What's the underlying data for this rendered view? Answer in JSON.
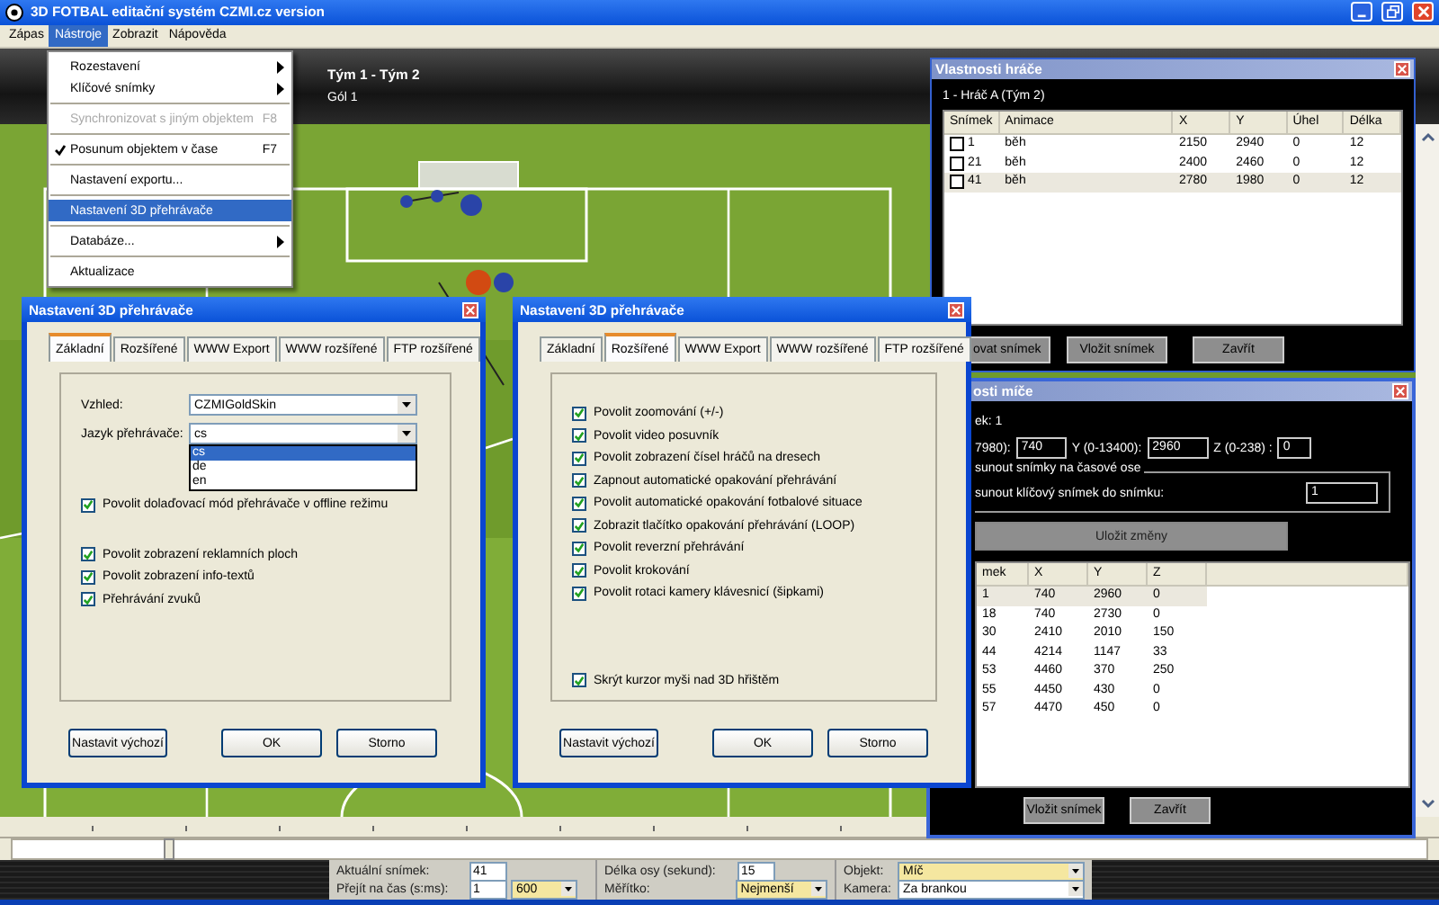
{
  "window": {
    "title": "3D FOTBAL editační systém CZMI.cz version",
    "menu": [
      {
        "label": "Zápas",
        "selected": false
      },
      {
        "label": "Nástroje",
        "selected": true
      },
      {
        "label": "Zobrazit",
        "selected": false
      },
      {
        "label": "Nápověda",
        "selected": false
      }
    ]
  },
  "menu_dropdown": [
    {
      "kind": "item",
      "label": "Rozestavení",
      "submenu": true,
      "disabled": false,
      "checked": false,
      "selected": false
    },
    {
      "kind": "item",
      "label": "Klíčové snímky",
      "submenu": true,
      "disabled": false,
      "checked": false,
      "selected": false
    },
    {
      "kind": "separator"
    },
    {
      "kind": "item",
      "label": "Synchronizovat s jiným objektem",
      "shortcut": "F8",
      "submenu": false,
      "disabled": true,
      "checked": false,
      "selected": false
    },
    {
      "kind": "separator"
    },
    {
      "kind": "item",
      "label": "Posunum objektem v čase",
      "shortcut": "F7",
      "submenu": false,
      "disabled": false,
      "checked": true,
      "selected": false
    },
    {
      "kind": "separator"
    },
    {
      "kind": "item",
      "label": "Nastavení exportu...",
      "submenu": false,
      "disabled": false,
      "checked": false,
      "selected": false
    },
    {
      "kind": "separator"
    },
    {
      "kind": "item",
      "label": "Nastavení 3D přehrávače",
      "submenu": false,
      "disabled": false,
      "checked": false,
      "selected": true
    },
    {
      "kind": "separator"
    },
    {
      "kind": "item",
      "label": "Databáze...",
      "submenu": true,
      "disabled": false,
      "checked": false,
      "selected": false
    },
    {
      "kind": "separator"
    },
    {
      "kind": "item",
      "label": "Aktualizace",
      "submenu": false,
      "disabled": false,
      "checked": false,
      "selected": false
    }
  ],
  "header": {
    "match": "Tým 1 - Tým 2",
    "event": "Gól 1"
  },
  "player_window": {
    "title": "Vlastnosti hráče",
    "subtitle": "1 - Hráč A (Tým 2)",
    "columns": [
      "Snímek",
      "Animace",
      "X",
      "Y",
      "Úhel",
      "Délka"
    ],
    "rows": [
      {
        "checked": false,
        "selected": false,
        "cells": [
          "1",
          "běh",
          "2150",
          "2940",
          "0",
          "12"
        ]
      },
      {
        "checked": false,
        "selected": false,
        "cells": [
          "21",
          "běh",
          "2400",
          "2460",
          "0",
          "12"
        ]
      },
      {
        "checked": false,
        "selected": true,
        "cells": [
          "41",
          "běh",
          "2780",
          "1980",
          "0",
          "12"
        ]
      }
    ],
    "buttons": [
      "ovat snímek",
      "Vložit snímek",
      "Zavřít"
    ]
  },
  "ball_window": {
    "title": "osti míče",
    "frame": "ek: 1",
    "coords": [
      {
        "label": "7980):",
        "value": "740"
      },
      {
        "label": "Y (0-13400):",
        "value": "2960"
      },
      {
        "label": "Z (0-238) :",
        "value": "0"
      }
    ],
    "group": {
      "legend": "sunout snímky na časové ose",
      "label": "sunout klíčový snímek do snímku:",
      "value": "1"
    },
    "save_button": "Uložit změny",
    "columns": [
      "mek",
      "X",
      "Y",
      "Z"
    ],
    "rows": [
      {
        "selected": true,
        "cells": [
          "1",
          "740",
          "2960",
          "0"
        ]
      },
      {
        "selected": false,
        "cells": [
          "18",
          "740",
          "2730",
          "0"
        ]
      },
      {
        "selected": false,
        "cells": [
          "30",
          "2410",
          "2010",
          "150"
        ]
      },
      {
        "selected": false,
        "cells": [
          "44",
          "4214",
          "1147",
          "33"
        ]
      },
      {
        "selected": false,
        "cells": [
          "53",
          "4460",
          "370",
          "250"
        ]
      },
      {
        "selected": false,
        "cells": [
          "55",
          "4450",
          "430",
          "0"
        ]
      },
      {
        "selected": false,
        "cells": [
          "57",
          "4470",
          "450",
          "0"
        ]
      }
    ],
    "buttons": [
      "Vložit snímek",
      "Zavřít"
    ]
  },
  "dialogs": [
    {
      "kind": "basic",
      "title": "Nastavení 3D přehrávače",
      "tabs": [
        {
          "label": "Základní",
          "selected": true
        },
        {
          "label": "Rozšířené",
          "selected": false
        },
        {
          "label": "WWW Export",
          "selected": false
        },
        {
          "label": "WWW rozšířené",
          "selected": false
        },
        {
          "label": "FTP rozšířené",
          "selected": false
        }
      ],
      "fields": [
        {
          "label": "Vzhled:",
          "value": "CZMIGoldSkin"
        },
        {
          "label": "Jazyk přehrávače:",
          "value": "cs",
          "options": [
            {
              "label": "cs",
              "selected": true
            },
            {
              "label": "de",
              "selected": false
            },
            {
              "label": "en",
              "selected": false
            }
          ]
        }
      ],
      "checkbox_groups": [
        [
          {
            "label": "Povolit dolaďovací mód přehrávače v offline režimu",
            "checked": true
          }
        ],
        [
          {
            "label": "Povolit zobrazení reklamních ploch",
            "checked": true
          },
          {
            "label": "Povolit zobrazení info-textů",
            "checked": true
          },
          {
            "label": "Přehrávání zvuků",
            "checked": true
          }
        ]
      ],
      "buttons": [
        "Nastavit výchozí",
        "OK",
        "Storno"
      ]
    },
    {
      "kind": "advanced",
      "title": "Nastavení 3D přehrávače",
      "tabs": [
        {
          "label": "Základní",
          "selected": false
        },
        {
          "label": "Rozšířené",
          "selected": true
        },
        {
          "label": "WWW Export",
          "selected": false
        },
        {
          "label": "WWW rozšířené",
          "selected": false
        },
        {
          "label": "FTP rozšířené",
          "selected": false
        }
      ],
      "checkbox_groups": [
        [
          {
            "label": "Povolit zoomování (+/-)",
            "checked": true
          },
          {
            "label": "Povolit video posuvník",
            "checked": true
          },
          {
            "label": "Povolit zobrazení čísel hráčů na dresech",
            "checked": true
          },
          {
            "label": "Zapnout automatické opakování přehrávání",
            "checked": true
          },
          {
            "label": "Povolit automatické opakování fotbalové situace",
            "checked": true
          },
          {
            "label": "Zobrazit tlačítko opakování přehrávání (LOOP)",
            "checked": true
          },
          {
            "label": "Povolit reverzní přehrávání",
            "checked": true
          },
          {
            "label": "Povolit krokování",
            "checked": true
          },
          {
            "label": "Povolit rotaci kamery klávesnicí (šipkami)",
            "checked": true
          }
        ],
        [
          {
            "label": "Skrýt kurzor myši nad 3D hřištěm",
            "checked": true
          }
        ]
      ],
      "buttons": [
        "Nastavit výchozí",
        "OK",
        "Storno"
      ]
    }
  ],
  "bottom_panel": {
    "columns": [
      [
        {
          "label": "Aktuální snímek:",
          "inputs": [
            {
              "kind": "input",
              "value": "41"
            }
          ]
        },
        {
          "label": "Přejít na čas (s:ms):",
          "inputs": [
            {
              "kind": "input",
              "value": "1"
            },
            {
              "kind": "combo",
              "value": "600",
              "highlighted": true
            }
          ]
        }
      ],
      [
        {
          "label": "Délka osy (sekund):",
          "inputs": [
            {
              "kind": "input",
              "value": "15"
            }
          ]
        },
        {
          "label": "Měřítko:",
          "inputs": [
            {
              "kind": "combo",
              "value": "Nejmenší",
              "highlighted": true
            }
          ]
        }
      ],
      [
        {
          "label": "Objekt:",
          "inputs": [
            {
              "kind": "combo",
              "value": "Míč",
              "highlighted": true
            }
          ]
        },
        {
          "label": "Kamera:",
          "inputs": [
            {
              "kind": "combo",
              "value": "Za brankou",
              "highlighted": false
            }
          ]
        }
      ]
    ]
  }
}
